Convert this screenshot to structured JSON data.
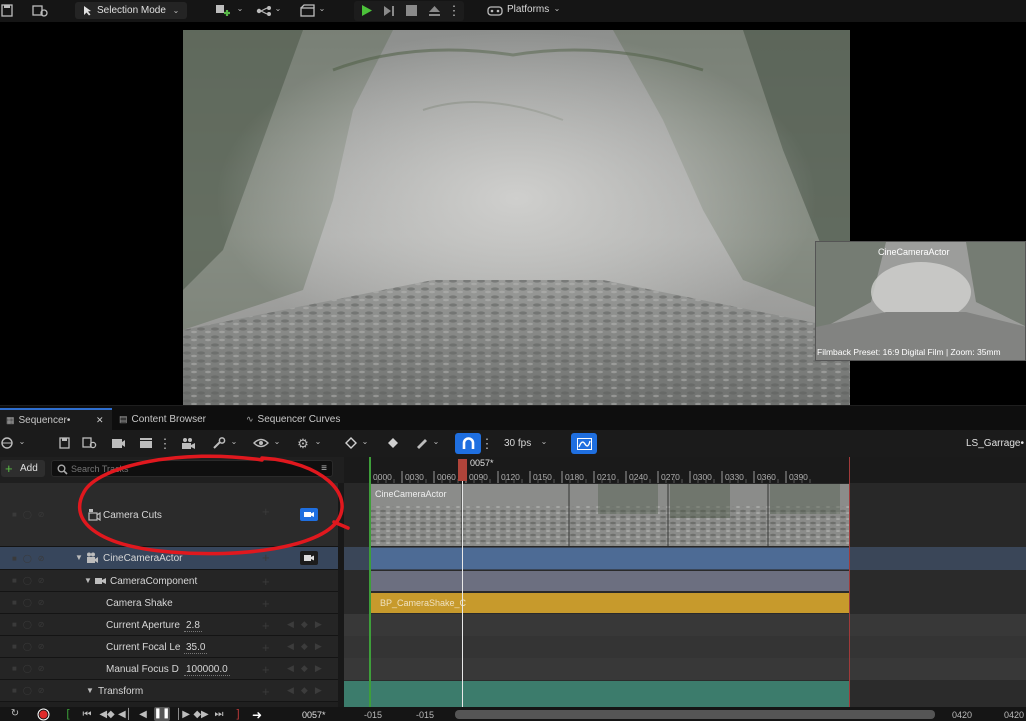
{
  "toolbar": {
    "mode_label": "Selection Mode",
    "platforms_label": "Platforms",
    "icons": [
      "save-icon",
      "content-icon",
      "selection-mode-icon",
      "add-actor-icon",
      "blueprint-icon",
      "cinematics-icon",
      "play-icon",
      "step-icon",
      "stop-icon",
      "eject-icon",
      "more-icon",
      "platforms-icon"
    ]
  },
  "viewport": {
    "pip_title": "CineCameraActor",
    "pip_footer": "Filmback Preset: 16:9 Digital Film | Zoom: 35mm"
  },
  "tabs": {
    "sequencer": "Sequencer•",
    "content_browser": "Content Browser",
    "sequencer_curves": "Sequencer Curves"
  },
  "seq_toolbar": {
    "fps": "30 fps",
    "sequence_name": "LS_Garrage•"
  },
  "tree": {
    "add_label": "Add",
    "search_placeholder": "Search Tracks",
    "rows": {
      "camera_cuts": "Camera Cuts",
      "cine_actor": "CineCameraActor",
      "camera_component": "CameraComponent",
      "camera_shake": "Camera Shake",
      "aperture": "Current Aperture",
      "aperture_value": "2.8",
      "focal": "Current Focal Le",
      "focal_value": "35.0",
      "focus": "Manual Focus D",
      "focus_value": "100000.0",
      "transform": "Transform"
    }
  },
  "timeline": {
    "current_frame": "0057*",
    "ticks": [
      "0000",
      "0030",
      "0060",
      "0090",
      "0120",
      "0150",
      "0180",
      "0210",
      "0240",
      "0270",
      "0300",
      "0330",
      "0360",
      "0390"
    ],
    "camera_section_label": "CineCameraActor",
    "shake_section_label": "BP_CameraShake_C"
  },
  "bottom": {
    "current_frame": "0057*",
    "range_start": "-015",
    "range_start2": "-015",
    "range_end": "0420",
    "range_end2": "0420"
  },
  "colors": {
    "accent_blue": "#1f6fe0",
    "camera_track": "#4d6b95",
    "component_track": "#6c6f80",
    "shake_section": "#c79a2c",
    "transform_track": "#3c7c6c",
    "playhead_marker": "#b0443a",
    "annotation": "#e0181e"
  }
}
